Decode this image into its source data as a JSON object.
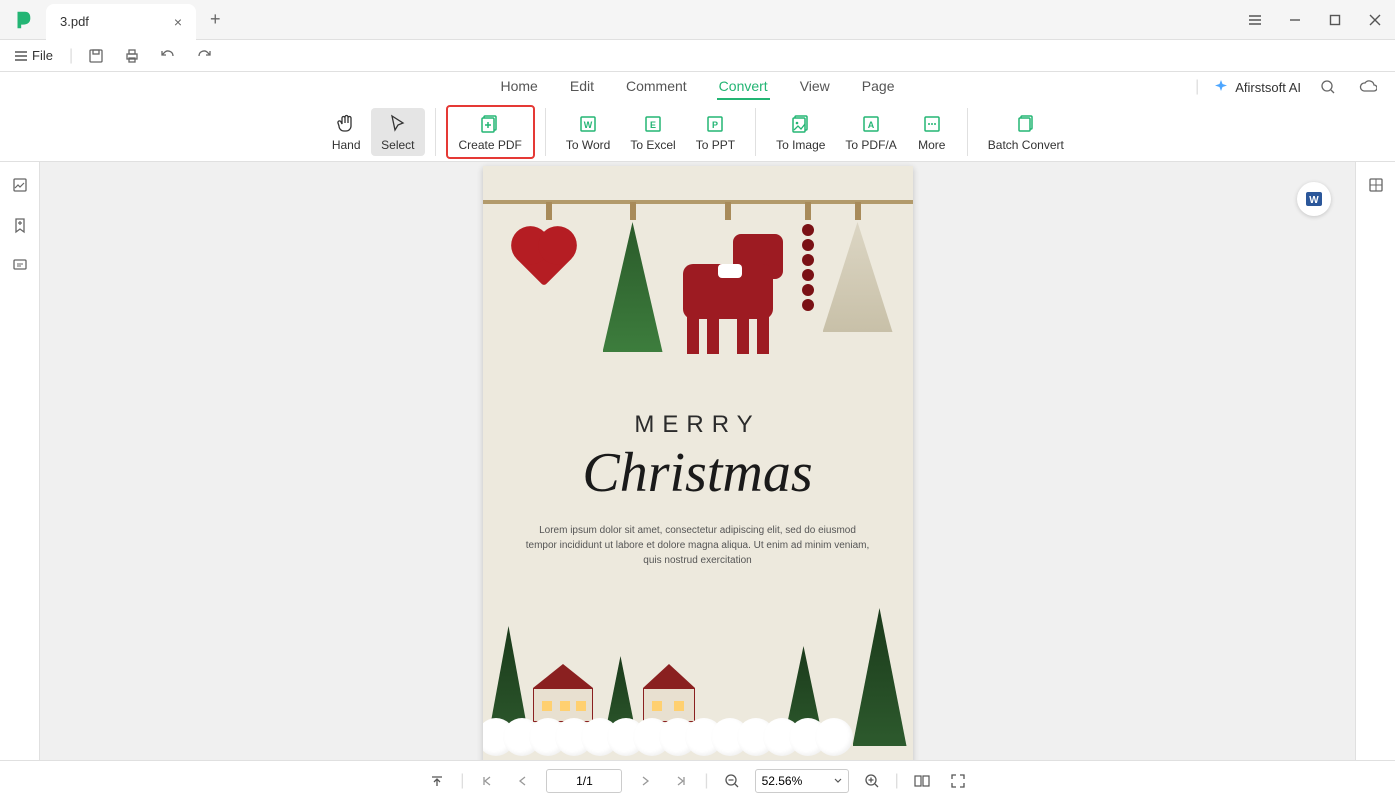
{
  "titlebar": {
    "tab_title": "3.pdf",
    "tab_close": "×",
    "tab_add": "+"
  },
  "filebar": {
    "file_label": "File"
  },
  "menu": {
    "items": [
      "Home",
      "Edit",
      "Comment",
      "Convert",
      "View",
      "Page"
    ],
    "active_index": 3,
    "ai_label": "Afirstsoft AI"
  },
  "ribbon": {
    "hand": "Hand",
    "select": "Select",
    "create_pdf": "Create PDF",
    "to_word": "To Word",
    "to_excel": "To Excel",
    "to_ppt": "To PPT",
    "to_image": "To Image",
    "to_pdfa": "To PDF/A",
    "more": "More",
    "batch_convert": "Batch Convert"
  },
  "document": {
    "merry": "MERRY",
    "christmas": "Christmas",
    "lorem": "Lorem ipsum dolor sit amet, consectetur adipiscing elit, sed do eiusmod tempor incididunt ut labore et dolore magna aliqua. Ut enim ad minim veniam, quis nostrud exercitation"
  },
  "statusbar": {
    "page_display": "1/1",
    "zoom_value": "52.56%"
  }
}
